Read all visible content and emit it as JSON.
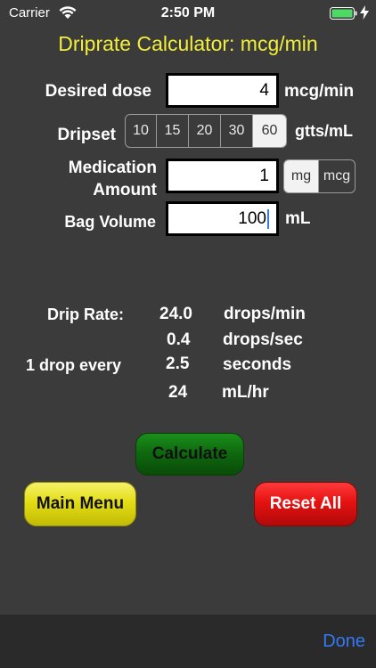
{
  "status_bar": {
    "carrier": "Carrier",
    "time": "2:50 PM",
    "icons": [
      "wifi-icon",
      "battery-icon",
      "charging-icon"
    ]
  },
  "title": "Driprate Calculator: mcg/min",
  "title_color": "#f2ef3a",
  "form": {
    "desired_dose": {
      "label": "Desired dose",
      "value": "4",
      "unit": "mcg/min"
    },
    "dripset": {
      "label": "Dripset",
      "options": [
        "10",
        "15",
        "20",
        "30",
        "60"
      ],
      "selected": "60",
      "unit": "gtts/mL"
    },
    "medication_amount": {
      "label_line1": "Medication",
      "label_line2": "Amount",
      "value": "1",
      "unit_options": [
        "mg",
        "mcg"
      ],
      "unit_selected": "mg"
    },
    "bag_volume": {
      "label": "Bag Volume",
      "value": "100",
      "unit": "mL"
    }
  },
  "results": {
    "drip_rate_label": "Drip Rate:",
    "drops_per_min": {
      "value": "24.0",
      "unit": "drops/min"
    },
    "drops_per_sec": {
      "value": "0.4",
      "unit": "drops/sec"
    },
    "drop_every_label": "1 drop every",
    "seconds": {
      "value": "2.5",
      "unit": "seconds"
    },
    "ml_per_hr": {
      "value": "24",
      "unit": "mL/hr"
    }
  },
  "buttons": {
    "calculate": "Calculate",
    "main_menu": "Main Menu",
    "reset_all": "Reset All"
  },
  "toolbar": {
    "done": "Done"
  },
  "colors": {
    "accent": "#3478f6",
    "calculate": "#0f6a0f",
    "main_menu": "#e3dd15",
    "reset": "#e51212",
    "background": "#3b3b3b"
  }
}
